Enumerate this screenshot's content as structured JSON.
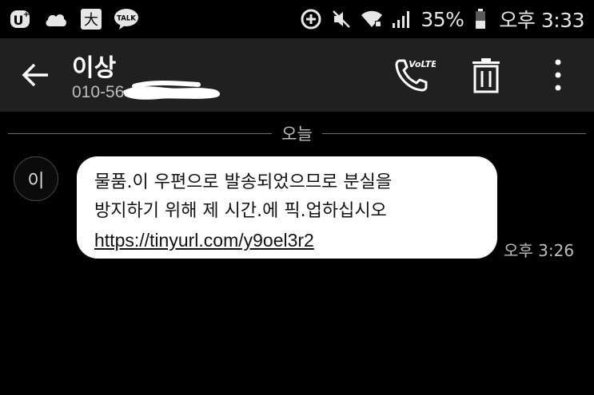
{
  "status_bar": {
    "left_icons": [
      "u-plus-icon",
      "cloud-icon",
      "daum-icon",
      "kakaotalk-icon"
    ],
    "kakao_label": "TALK",
    "daum_glyph": "大",
    "right_icons": [
      "data-saver-icon",
      "mute-icon",
      "wifi-icon",
      "signal-icon",
      "battery-icon"
    ],
    "battery_percent": "35%",
    "time": "오후 3:33"
  },
  "header": {
    "contact_name": "이상",
    "contact_number": "010-56",
    "call_badge": "VoLTE",
    "colors": {
      "background": "#202020"
    }
  },
  "conversation": {
    "date_label": "오늘",
    "messages": [
      {
        "avatar_text": "이",
        "lines": [
          "물품.이 우편으로 발송되었으므로 분실을",
          "방지하기 위해 제 시간.에 픽.업하십시오"
        ],
        "link": "https://tinyurl.com/y9oel3r2",
        "time": "오후 3:26"
      }
    ]
  }
}
